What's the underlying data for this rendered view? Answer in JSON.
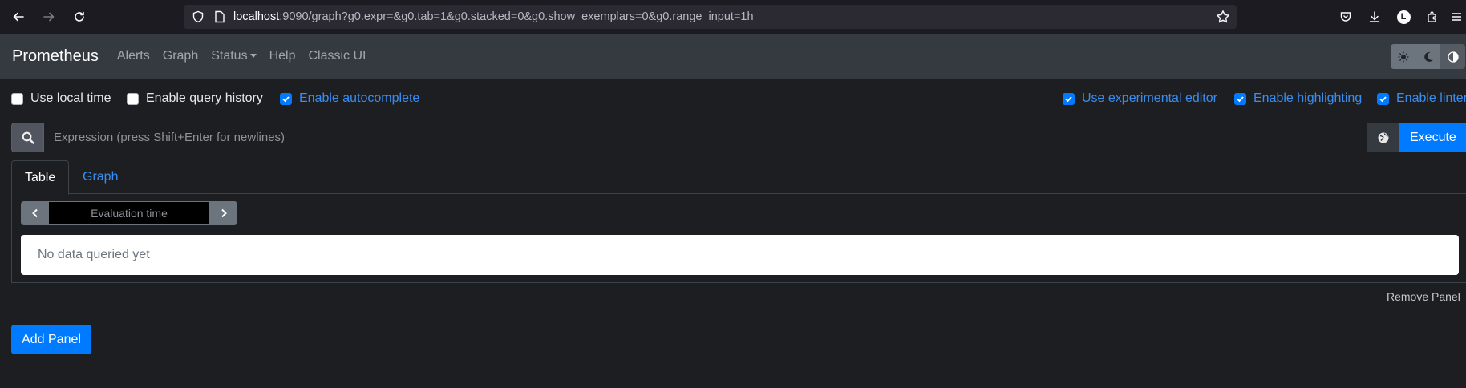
{
  "browser": {
    "url_host": "localhost",
    "url_rest": ":9090/graph?g0.expr=&g0.tab=1&g0.stacked=0&g0.show_exemplars=0&g0.range_input=1h"
  },
  "navbar": {
    "brand": "Prometheus",
    "links": [
      "Alerts",
      "Graph",
      "Status",
      "Help",
      "Classic UI"
    ]
  },
  "options": {
    "local_time": "Use local time",
    "query_history": "Enable query history",
    "autocomplete": "Enable autocomplete",
    "experimental_editor": "Use experimental editor",
    "highlighting": "Enable highlighting",
    "linter": "Enable linter"
  },
  "expression": {
    "placeholder": "Expression (press Shift+Enter for newlines)",
    "execute_label": "Execute"
  },
  "tabs": {
    "table": "Table",
    "graph": "Graph"
  },
  "panel": {
    "eval_placeholder": "Evaluation time",
    "no_data": "No data queried yet",
    "remove_panel": "Remove Panel"
  },
  "add_panel": "Add Panel",
  "colors": {
    "accent": "#007bff",
    "navbar": "#343a40",
    "background": "#1c1e22"
  }
}
